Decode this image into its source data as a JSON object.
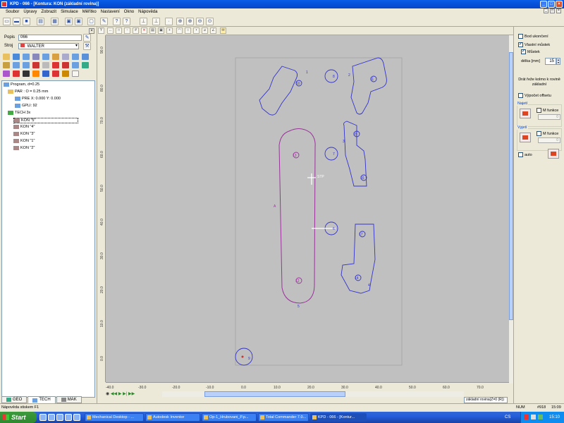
{
  "window": {
    "title": "KPD - 066 - [Kontura: KON (základní rovina)]"
  },
  "menu": [
    "Soubor",
    "Úpravy",
    "Zobrazit",
    "Simulace",
    "Měřítko",
    "Nastavení",
    "Okno",
    "Nápověda"
  ],
  "left_panel": {
    "popis_label": "Popis",
    "popis_value": "066",
    "stroj_label": "Stroj",
    "stroj_value": "WALTER",
    "tree": [
      {
        "label": "Program, d=0.25",
        "icon": "program-icon",
        "indent": 0
      },
      {
        "label": "PAR : O = 0.25 mm",
        "icon": "par-icon",
        "indent": 1
      },
      {
        "label": "PRE  X:   0.000  Y:   0.000",
        "icon": "pre-icon",
        "indent": 2
      },
      {
        "label": "GPLI: 92",
        "icon": "gpli-icon",
        "indent": 2
      },
      {
        "label": "TECH 3x",
        "icon": "tech-icon",
        "indent": 1
      },
      {
        "label": "KON \"5\"",
        "icon": "contour-icon",
        "indent": 2,
        "selected": true
      },
      {
        "label": "KON \"4\"",
        "icon": "contour-icon",
        "indent": 2
      },
      {
        "label": "KON \"3\"",
        "icon": "contour-icon",
        "indent": 2
      },
      {
        "label": "KON \"1\"",
        "icon": "contour-icon",
        "indent": 2
      },
      {
        "label": "KON \"2\"",
        "icon": "contour-icon",
        "indent": 2
      }
    ],
    "tabs": [
      {
        "label": "GEO",
        "active": false
      },
      {
        "label": "TECH",
        "active": true
      },
      {
        "label": "MAK",
        "active": false
      }
    ]
  },
  "right_panel": {
    "bod_ukonceni": "Bod ukončení",
    "vlastni_mustek": "Vlastní můstek",
    "mustek": "Můstek",
    "delka_label": "délka [mm]",
    "delka_value": "15",
    "info_text_1": "Drát řeže kolmo k rovině",
    "info_text_2": "základní",
    "vypocet_offsetu": "Výpočet offsetu",
    "najeti": "Najetí",
    "vyjeti": "Vyjetí",
    "m_funkce": "M funkce",
    "m_value": "0",
    "auto": "auto"
  },
  "canvas": {
    "y_ticks": [
      "90.0",
      "80.0",
      "70.0",
      "60.0",
      "50.0",
      "40.0",
      "30.0",
      "20.0",
      "10.0",
      "0.0"
    ],
    "x_ticks": [
      "-40.0",
      "-30.0",
      "-20.0",
      "-10.0",
      "0.0",
      "10.0",
      "20.0",
      "30.0",
      "40.0",
      "50.0",
      "60.0",
      "70.0"
    ],
    "labels": {
      "stp": "STP",
      "l1": "1",
      "l2": "2",
      "l3": "3",
      "l4": "4",
      "l5": "5",
      "c10": "10",
      "c11": "11",
      "c15": "15",
      "c16": "16",
      "c12": "12",
      "c13": "13",
      "c14": "14",
      "c17": "17",
      "c8": "8",
      "c9": "9",
      "c7": "7",
      "c6": "6",
      "s8": "8",
      "a": "A"
    },
    "plane_label": "základní rovina(Z=0 (R))"
  },
  "status": {
    "help": "Nápověda stiskem F1",
    "num": "NUM",
    "coords": "#918",
    "time": "15:09"
  },
  "taskbar": {
    "start": "Start",
    "tasks": [
      {
        "label": "Mechanical Desktop - ...",
        "active": false
      },
      {
        "label": "Autodesk Inventor",
        "active": false
      },
      {
        "label": "Op-1_Hrubovani_P.p...",
        "active": false
      },
      {
        "label": "Total Commander 7.0...",
        "active": false
      },
      {
        "label": "KPD - 066 - [Kontur...",
        "active": true
      }
    ],
    "lang": "CS",
    "clock": "15:10"
  },
  "colors": {
    "contour_blue": "#3333cc",
    "contour_purple": "#993399",
    "canvas_bg": "#c0c0c0",
    "xp_blue": "#0a5de8"
  }
}
